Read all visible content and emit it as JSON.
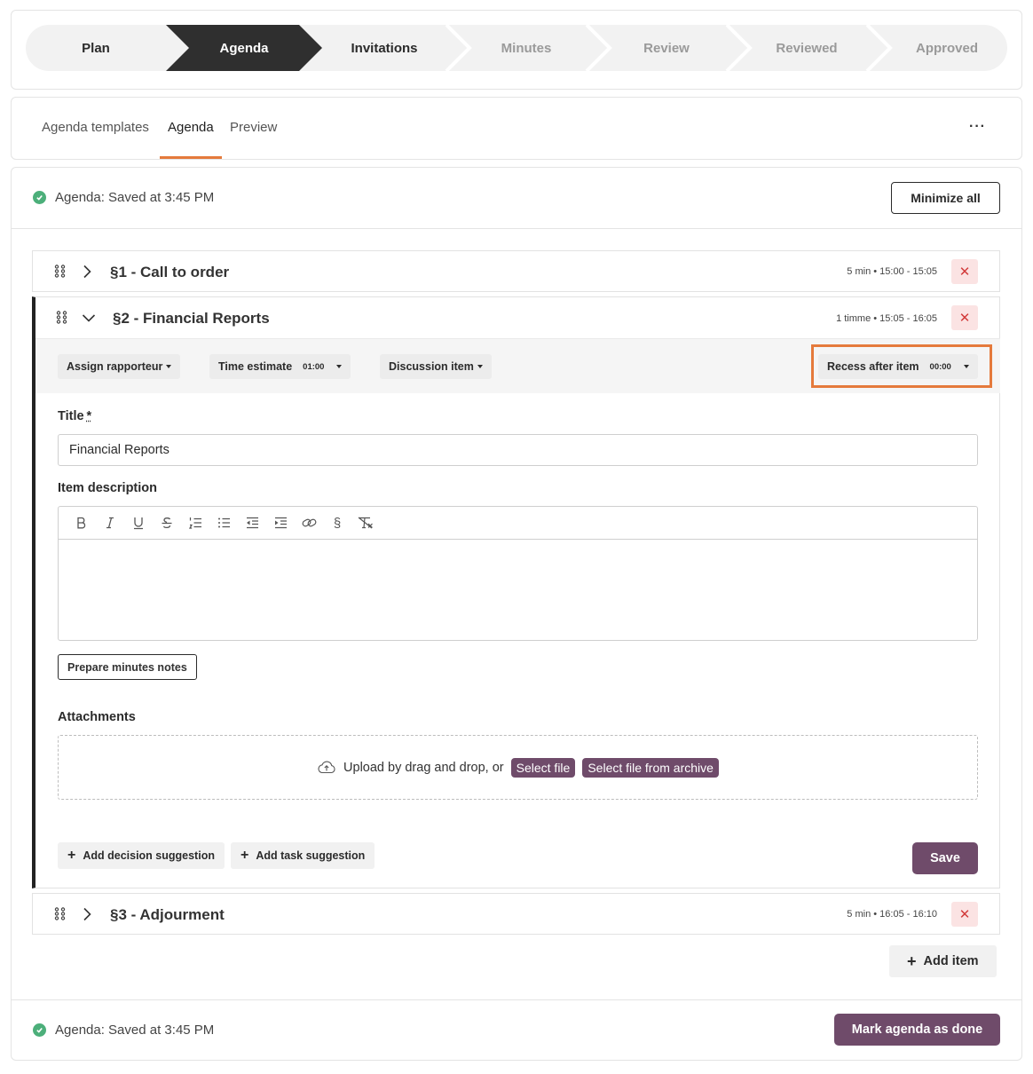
{
  "stepper": {
    "steps": [
      {
        "label": "Plan",
        "state": "done"
      },
      {
        "label": "Agenda",
        "state": "active"
      },
      {
        "label": "Invitations",
        "state": "done"
      },
      {
        "label": "Minutes",
        "state": "todo"
      },
      {
        "label": "Review",
        "state": "todo"
      },
      {
        "label": "Reviewed",
        "state": "todo"
      },
      {
        "label": "Approved",
        "state": "todo"
      }
    ]
  },
  "tabs": {
    "items": [
      "Agenda templates",
      "Agenda",
      "Preview"
    ],
    "active": "Agenda",
    "more": "···"
  },
  "header": {
    "status": "Agenda: Saved at 3:45 PM",
    "minimize_label": "Minimize all"
  },
  "items": [
    {
      "title": "§1 - Call to order",
      "meta": "5 min • 15:00 - 15:05",
      "delete": "✕"
    },
    {
      "title": "§2 - Financial Reports",
      "meta": "1 timme • 15:05 - 16:05",
      "delete": "✕"
    },
    {
      "title": "§3 - Adjourment",
      "meta": "5 min • 16:05 - 16:10",
      "delete": "✕"
    }
  ],
  "expanded": {
    "assign_rapporteur": "Assign rapporteur",
    "time_estimate_label": "Time estimate",
    "time_estimate_value": "01:00",
    "discussion_item": "Discussion item",
    "recess_label": "Recess after item",
    "recess_value": "00:00",
    "title_label": "Title",
    "title_required": "*",
    "title_value": "Financial Reports",
    "description_label": "Item description",
    "toolbar_icons": [
      "bold-icon",
      "italic-icon",
      "underline-icon",
      "strikethrough-icon",
      "ordered-list-icon",
      "bullet-list-icon",
      "outdent-icon",
      "indent-icon",
      "link-icon",
      "section-icon",
      "clear-format-icon"
    ],
    "prepare_minutes": "Prepare minutes notes",
    "attachments_label": "Attachments",
    "upload_text": "Upload by drag and drop, or",
    "select_file": "Select file",
    "select_archive": "Select file from archive",
    "add_decision": "Add decision suggestion",
    "add_task": "Add task suggestion",
    "save": "Save"
  },
  "footer": {
    "add_item": "Add item",
    "status": "Agenda: Saved at 3:45 PM",
    "mark_done": "Mark agenda as done"
  },
  "colors": {
    "accent_orange": "#e57a3c",
    "primary_purple": "#6f4b6a",
    "success_green": "#4caf7a",
    "danger_red": "#d23b3b"
  }
}
